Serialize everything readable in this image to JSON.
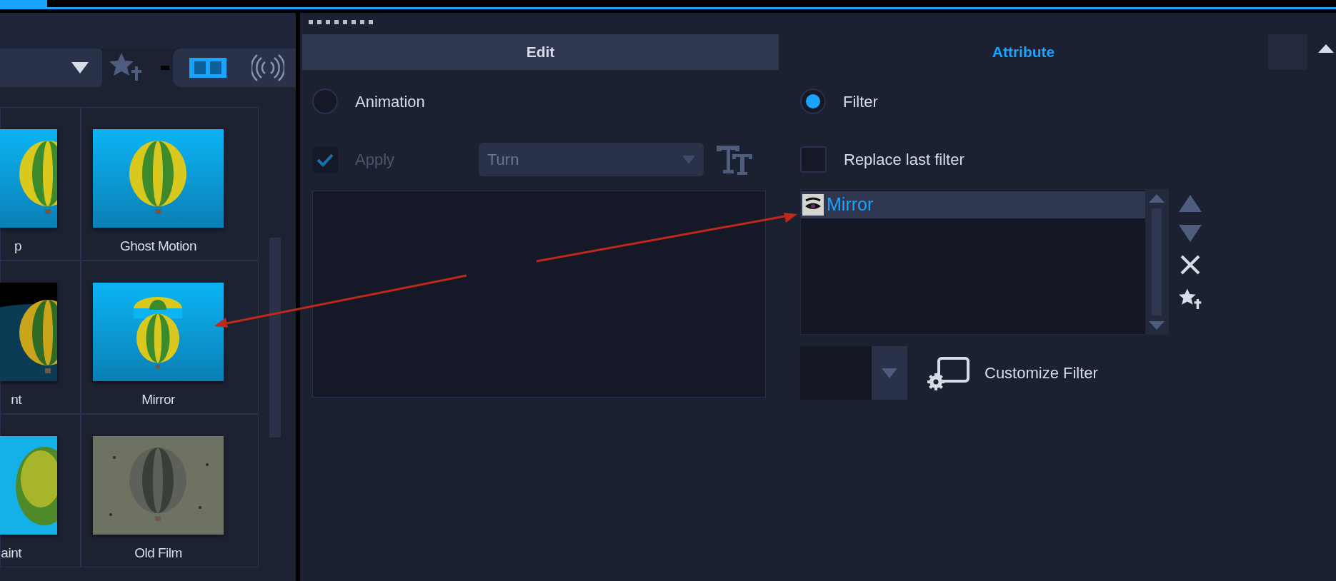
{
  "gallery": {
    "media_toggles": [
      {
        "kind": "video",
        "selected": true
      },
      {
        "kind": "audio",
        "selected": false
      }
    ],
    "tiles": [
      {
        "label": "p"
      },
      {
        "label": "Ghost Motion"
      },
      {
        "label": "nt"
      },
      {
        "label": "Mirror"
      },
      {
        "label": "aint"
      },
      {
        "label": "Old Film"
      }
    ]
  },
  "tabs": [
    {
      "label": "Edit",
      "selected": false
    },
    {
      "label": "Attribute",
      "selected": true
    }
  ],
  "edit": {
    "animation": {
      "label": "Animation",
      "selected": false
    },
    "apply": {
      "label": "Apply",
      "checked": true,
      "disabled": true
    },
    "preset": {
      "value": "Turn",
      "disabled": true
    }
  },
  "attribute": {
    "filter": {
      "label": "Filter",
      "selected": true
    },
    "replace_last_filter": {
      "label": "Replace last filter",
      "checked": false
    },
    "filters": [
      {
        "label": "Mirror",
        "selected": true
      }
    ],
    "customize_button": "Customize Filter"
  }
}
